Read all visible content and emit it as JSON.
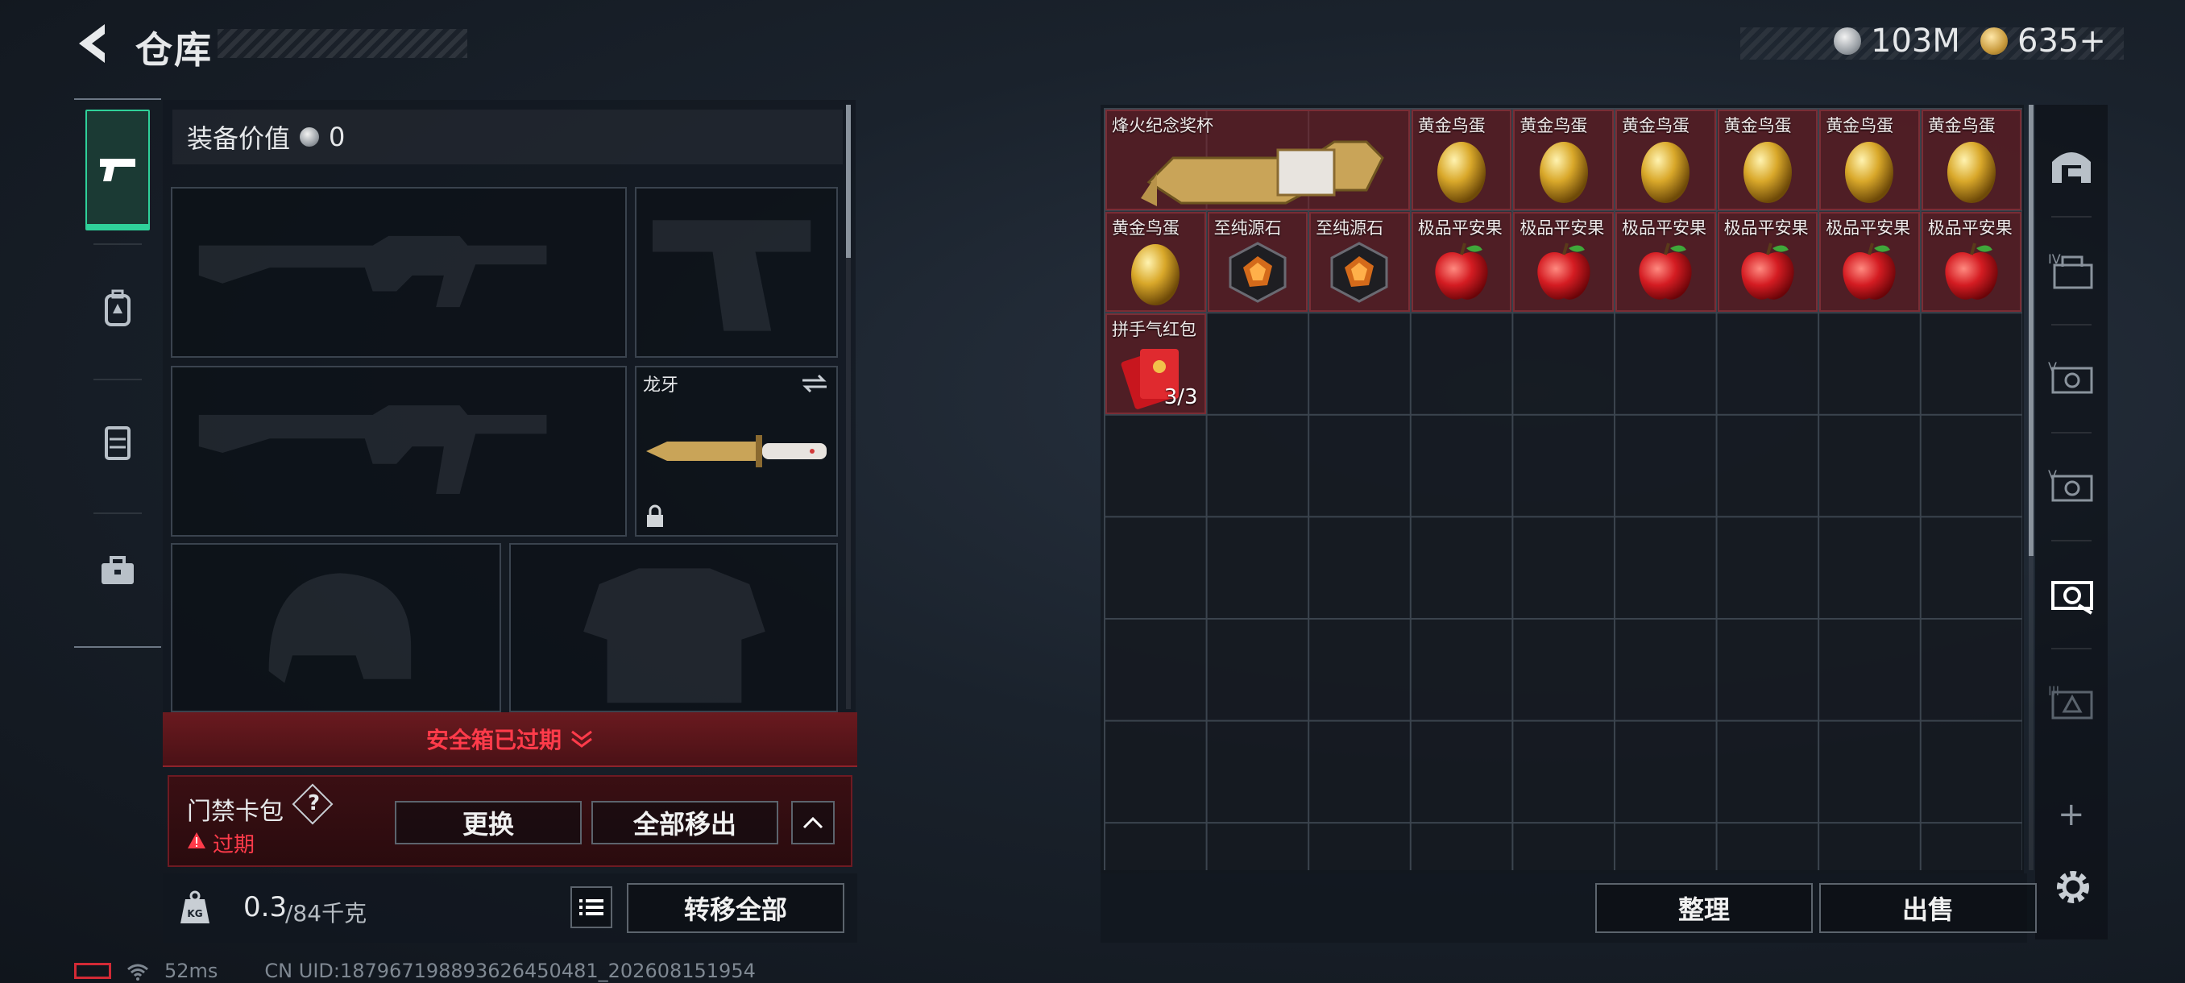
{
  "header": {
    "title": "仓库",
    "currency_silver": "103M",
    "currency_gold": "635+"
  },
  "equipment": {
    "value_label": "装备价值",
    "value": "0",
    "melee_name": "龙牙"
  },
  "safe_box": {
    "status": "安全箱已过期"
  },
  "card_pack": {
    "label": "门禁卡包",
    "help": "?",
    "expired_label": "过期",
    "replace_button": "更换",
    "remove_all_button": "全部移出"
  },
  "weight": {
    "current": "0.3",
    "capacity": "/84千克",
    "transfer_all_button": "转移全部"
  },
  "status_bar": {
    "ping": "52ms",
    "uid": "CN UID:1879671988936264504​81_202608151954"
  },
  "storage": {
    "items": [
      {
        "name": "烽火纪念奖杯",
        "kind": "trophy",
        "count": ""
      },
      {
        "name": "黄金鸟蛋",
        "kind": "egg",
        "count": ""
      },
      {
        "name": "黄金鸟蛋",
        "kind": "egg",
        "count": ""
      },
      {
        "name": "黄金鸟蛋",
        "kind": "egg",
        "count": ""
      },
      {
        "name": "黄金鸟蛋",
        "kind": "egg",
        "count": ""
      },
      {
        "name": "黄金鸟蛋",
        "kind": "egg",
        "count": ""
      },
      {
        "name": "黄金鸟蛋",
        "kind": "egg",
        "count": ""
      },
      {
        "name": "黄金鸟蛋",
        "kind": "egg",
        "count": ""
      },
      {
        "name": "至纯源石",
        "kind": "stone",
        "count": ""
      },
      {
        "name": "至纯源石",
        "kind": "stone",
        "count": ""
      },
      {
        "name": "极品平安果",
        "kind": "apple",
        "count": ""
      },
      {
        "name": "极品平安果",
        "kind": "apple",
        "count": ""
      },
      {
        "name": "极品平安果",
        "kind": "apple",
        "count": ""
      },
      {
        "name": "极品平安果",
        "kind": "apple",
        "count": ""
      },
      {
        "name": "极品平安果",
        "kind": "apple",
        "count": ""
      },
      {
        "name": "极品平安果",
        "kind": "apple",
        "count": ""
      },
      {
        "name": "拼手气红包",
        "kind": "redpacket",
        "count": "3/3"
      }
    ],
    "sort_button": "整理",
    "sell_button": "出售"
  },
  "right_rail": {
    "tabs": [
      "safehouse-icon",
      "storage-page-4-icon",
      "storage-page-5-icon",
      "storage-page-5b-icon",
      "storage-page-active-icon",
      "storage-page-locked-icon"
    ],
    "add": "+"
  },
  "colors": {
    "accent_green": "#2fd19a",
    "alert_red": "#ff3b4a",
    "item_bg_red": "#802028"
  }
}
